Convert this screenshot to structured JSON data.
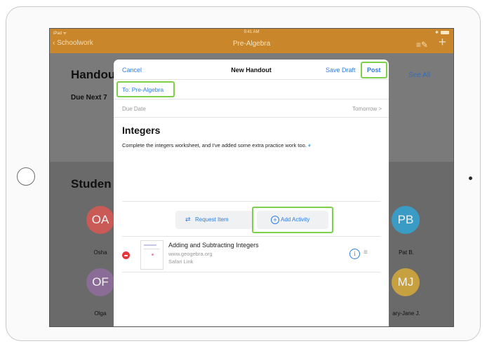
{
  "status": {
    "carrier": "iPad ᯤ",
    "time": "9:41 AM",
    "battery": "⁑"
  },
  "nav": {
    "back_label": "‹ Schoolwork",
    "title": "Pre-Algebra"
  },
  "background": {
    "handouts_heading": "Handou",
    "due_label": "Due Next 7",
    "see_all": "See All",
    "students_heading": "Studen",
    "students": [
      {
        "initials": "OA",
        "name": "Osha",
        "color": "#c95a55"
      },
      {
        "initials": "OF",
        "name": "Olga",
        "color": "#8b6c97"
      },
      {
        "initials": "PB",
        "name": "Pat B.",
        "color": "#3a9cc4"
      },
      {
        "initials": "MJ",
        "name": "ary-Jane J.",
        "color": "#c7a040"
      }
    ]
  },
  "modal": {
    "cancel": "Cancel",
    "title": "New Handout",
    "save_draft": "Save Draft",
    "post": "Post",
    "to_line": "To: Pre-Algebra",
    "due_label": "Due Date",
    "due_value": "Tomorrow  >",
    "heading": "Integers",
    "body": "Complete the integers worksheet, and I've added some extra practice work too.",
    "request_item": "Request Item",
    "add_activity": "Add Activity",
    "activity": {
      "title": "Adding and Subtracting Integers",
      "url": "www.geogebra.org",
      "type": "Safari Link"
    }
  },
  "colors": {
    "accent": "#2f7de0",
    "navbar": "#c9862a",
    "highlight": "#7cd148",
    "delete": "#e5383b"
  }
}
